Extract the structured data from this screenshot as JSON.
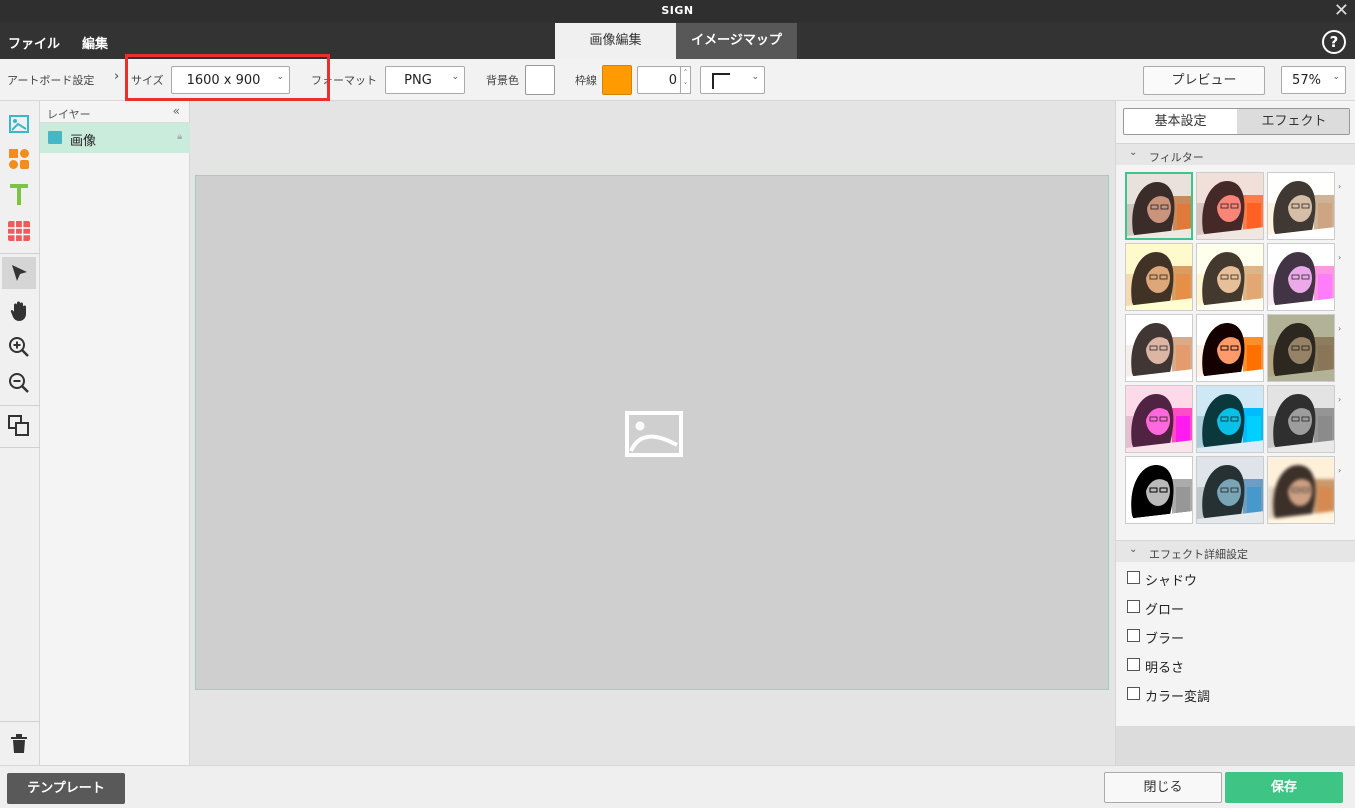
{
  "window": {
    "title": "SIGN"
  },
  "menubar": {
    "file": "ファイル",
    "edit": "編集",
    "tabs": [
      {
        "label": "画像編集",
        "active": true
      },
      {
        "label": "イメージマップ",
        "active": false
      }
    ],
    "help": "?"
  },
  "toolbar": {
    "artboard_label": "アートボード設定",
    "breadcrumb_sep": "›",
    "size_label": "サイズ",
    "size_value": "1600 x 900",
    "format_label": "フォーマット",
    "format_value": "PNG",
    "bg_label": "背景色",
    "bg_color": "#ffffff",
    "border_label": "枠線",
    "border_color": "#ff9a00",
    "border_width": "0",
    "border_style": "corner-line",
    "preview_button": "プレビュー",
    "zoom": "57%"
  },
  "layers": {
    "title": "レイヤー",
    "collapse": "«",
    "items": [
      {
        "name": "画像",
        "type": "image",
        "locked": true
      }
    ]
  },
  "right_panel": {
    "tabs": [
      {
        "label": "基本設定",
        "active": false
      },
      {
        "label": "エフェクト",
        "active": true
      }
    ],
    "filter_title": "フィルター",
    "filters_selected_index": 0,
    "effect_title": "エフェクト詳細設定",
    "effects": [
      {
        "label": "シャドウ",
        "checked": false
      },
      {
        "label": "グロー",
        "checked": false
      },
      {
        "label": "ブラー",
        "checked": false
      },
      {
        "label": "明るさ",
        "checked": false
      },
      {
        "label": "カラー変調",
        "checked": false
      }
    ]
  },
  "bottom": {
    "template_button": "テンプレート",
    "close_button": "閉じる",
    "save_button": "保存"
  },
  "colors": {
    "accent_green": "#3ec585",
    "highlight_red": "#e8312a",
    "titlebar": "#2f2f2f"
  }
}
